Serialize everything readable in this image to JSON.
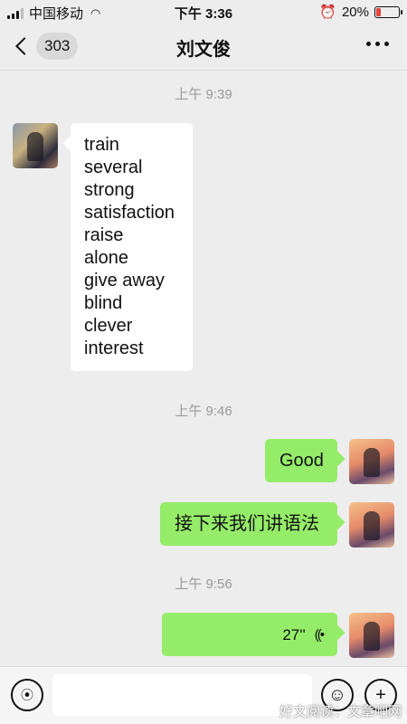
{
  "status_bar": {
    "carrier": "中国移动",
    "time": "下午 3:36",
    "battery_percent": "20%",
    "alarm_icon": "alarm-clock-icon",
    "wifi_icon": "wifi-icon",
    "battery_level": 0.2
  },
  "nav": {
    "unread_count": "303",
    "title": "刘文俊",
    "back_icon": "chevron-left-icon",
    "more_icon": "more-dots-icon"
  },
  "messages": {
    "timestamps": [
      "上午 9:39",
      "上午 9:46",
      "上午 9:56"
    ],
    "incoming_words": [
      "train",
      "several",
      "strong",
      "satisfaction",
      "raise",
      "alone",
      "give away",
      "blind",
      "clever",
      "interest"
    ],
    "outgoing_1": "Good",
    "outgoing_2": "接下来我们讲语法",
    "voice_duration": "27''"
  },
  "input_bar": {
    "voice_icon": "voice-mode-icon",
    "emoji_icon": "emoji-icon",
    "plus_icon": "plus-icon",
    "placeholder": ""
  },
  "watermark": "好文阅读：文章吧网",
  "colors": {
    "background": "#ededed",
    "outgoing_bubble": "#95ec69",
    "incoming_bubble": "#ffffff",
    "timestamp_text": "#999999"
  }
}
